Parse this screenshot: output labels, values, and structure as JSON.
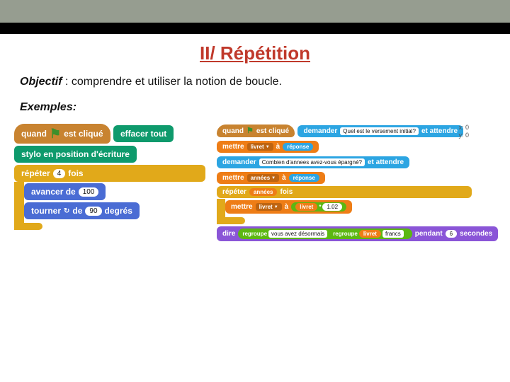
{
  "header": {
    "title": "II/ Répétition"
  },
  "text": {
    "objectif_label": "Objectif",
    "objectif_body": " : comprendre et utiliser la notion de boucle.",
    "exemples_label": "Exemples:"
  },
  "left": {
    "when": {
      "a": "quand",
      "b": "est cliqué"
    },
    "erase": "effacer tout",
    "pendown": "stylo en position d'écriture",
    "repeat": {
      "label": "répéter",
      "count": "4",
      "suffix": "fois"
    },
    "move": {
      "a": "avancer de",
      "v": "100"
    },
    "turn": {
      "a": "tourner",
      "b": "de",
      "v": "90",
      "c": "degrés"
    }
  },
  "right": {
    "when": {
      "a": "quand",
      "b": "est cliqué"
    },
    "ask1": {
      "a": "demander",
      "q": "Quel est le versement initial?",
      "b": "et attendre"
    },
    "set1": {
      "a": "mettre",
      "var": "livret",
      "b": "à",
      "val": "réponse"
    },
    "ask2": {
      "a": "demander",
      "q": "Combien d'annees avez-vous épargné?",
      "b": "et attendre"
    },
    "set2": {
      "a": "mettre",
      "var": "années",
      "b": "à",
      "val": "réponse"
    },
    "repeat": {
      "label": "répéter",
      "var": "années",
      "suffix": "fois"
    },
    "set3": {
      "a": "mettre",
      "var": "livret",
      "b": "à",
      "inner_var": "livret",
      "mul": "1.02"
    },
    "say": {
      "a": "dire",
      "join": "regroupe",
      "t1": "vous avez désormais",
      "var": "livret",
      "t2": "francs",
      "b": "pendant",
      "sec": "6",
      "c": "secondes"
    },
    "coords": {
      "x": "x: 0",
      "y": "y: 0"
    }
  }
}
